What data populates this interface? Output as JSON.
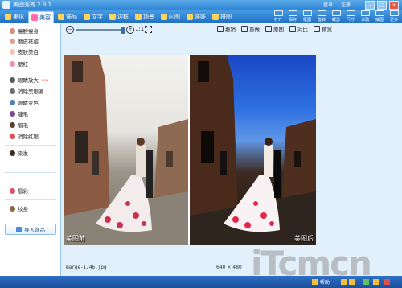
{
  "window": {
    "title": "美图秀秀 2.3.1",
    "login": "登录",
    "register": "注册"
  },
  "tabs": [
    {
      "label": "美化",
      "icon": "brush-icon"
    },
    {
      "label": "美容",
      "icon": "face-icon"
    },
    {
      "label": "饰品",
      "icon": "flower-icon"
    },
    {
      "label": "文字",
      "icon": "text-icon"
    },
    {
      "label": "边框",
      "icon": "frame-icon"
    },
    {
      "label": "场景",
      "icon": "scene-icon"
    },
    {
      "label": "闪图",
      "icon": "flash-icon"
    },
    {
      "label": "娃娃",
      "icon": "doll-icon"
    },
    {
      "label": "拼图",
      "icon": "puzzle-icon"
    }
  ],
  "tools": [
    {
      "label": "打开",
      "icon": "open-icon"
    },
    {
      "label": "保存",
      "icon": "save-icon"
    },
    {
      "label": "抠图",
      "icon": "cutout-icon"
    },
    {
      "label": "旋转",
      "icon": "rotate-icon"
    },
    {
      "label": "截剪",
      "icon": "crop-icon"
    },
    {
      "label": "尺寸",
      "icon": "size-icon"
    },
    {
      "label": "涂鸦",
      "icon": "doodle-icon"
    },
    {
      "label": "抽图",
      "icon": "extract-icon"
    },
    {
      "label": "更多",
      "icon": "more-icon"
    }
  ],
  "menu": [
    {
      "label": "瘦脸瘦身",
      "color": "#d98a7a"
    },
    {
      "label": "磨皮祛痘",
      "color": "#e0a08e"
    },
    {
      "label": "皮肤美白",
      "color": "#f1c6b0"
    },
    {
      "label": "腮红",
      "color": "#f08fb0"
    },
    {
      "label": "眼睛放大",
      "color": "#5a5a5a",
      "badge": "new"
    },
    {
      "label": "消除黑眼圈",
      "color": "#6e6e6e"
    },
    {
      "label": "眼睛变色",
      "color": "#4a7fb8"
    },
    {
      "label": "睫毛",
      "color": "#7a4a8a"
    },
    {
      "label": "眉毛",
      "color": "#5a4030"
    },
    {
      "label": "消除红眼",
      "color": "#e05050"
    },
    {
      "label": "染发",
      "color": "#3a2a20"
    },
    {
      "label": "唇彩",
      "color": "#e0506a"
    },
    {
      "label": "纹身",
      "color": "#8a6a40"
    }
  ],
  "import_button": "导入饰品",
  "subbar": {
    "zoom_ratio": "1:1",
    "undo": "撤销",
    "redo": "重做",
    "original": "原图",
    "compare": "对比",
    "preview": "预览"
  },
  "canvas": {
    "before_label": "美图前",
    "after_label": "美图后"
  },
  "status": {
    "filename": "marge-1746.jpg",
    "dims": "640 × 480"
  },
  "taskbar": {
    "text": "帮助"
  },
  "watermark": "iTcmcn"
}
